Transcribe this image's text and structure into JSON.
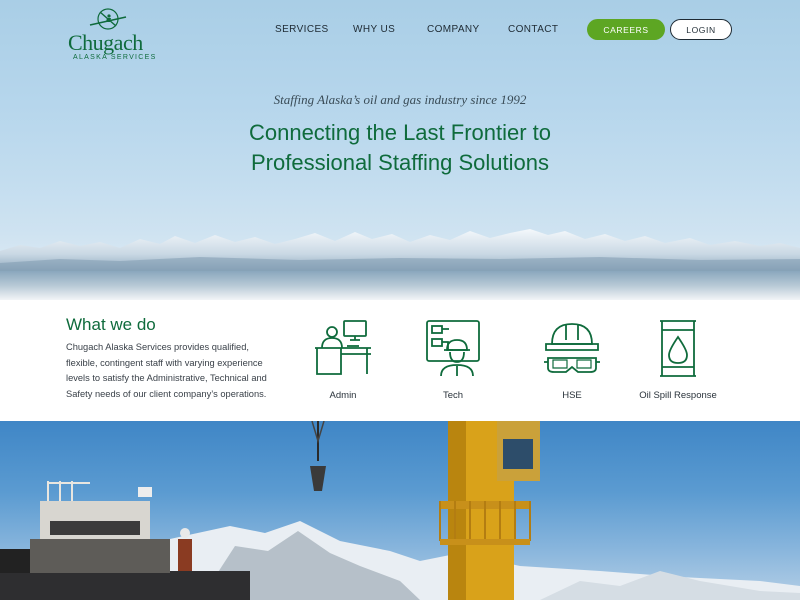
{
  "brand": {
    "name": "Chugach",
    "subtitle": "ALASKA SERVICES",
    "color": "#0f6b3c"
  },
  "nav": {
    "items": [
      "SERVICES",
      "WHY US",
      "COMPANY",
      "CONTACT"
    ],
    "careers_label": "CAREERS",
    "login_label": "LOGIN",
    "accent": "#5da623"
  },
  "hero": {
    "tagline": "Staffing Alaska’s oil and gas industry since 1992",
    "headline_line1": "Connecting the Last Frontier to",
    "headline_line2": "Professional Staffing Solutions"
  },
  "what_we_do": {
    "title": "What we do",
    "body": "Chugach Alaska Services provides qualified, flexible, contingent staff with varying experience levels to satisfy the Administrative, Technical and Safety needs of our client company’s operations.",
    "services": [
      {
        "label": "Admin",
        "icon": "admin-desk-icon"
      },
      {
        "label": "Tech",
        "icon": "tech-worker-icon"
      },
      {
        "label": "HSE",
        "icon": "hardhat-goggles-icon"
      },
      {
        "label": "Oil Spill Response",
        "icon": "oil-barrel-icon"
      }
    ]
  }
}
